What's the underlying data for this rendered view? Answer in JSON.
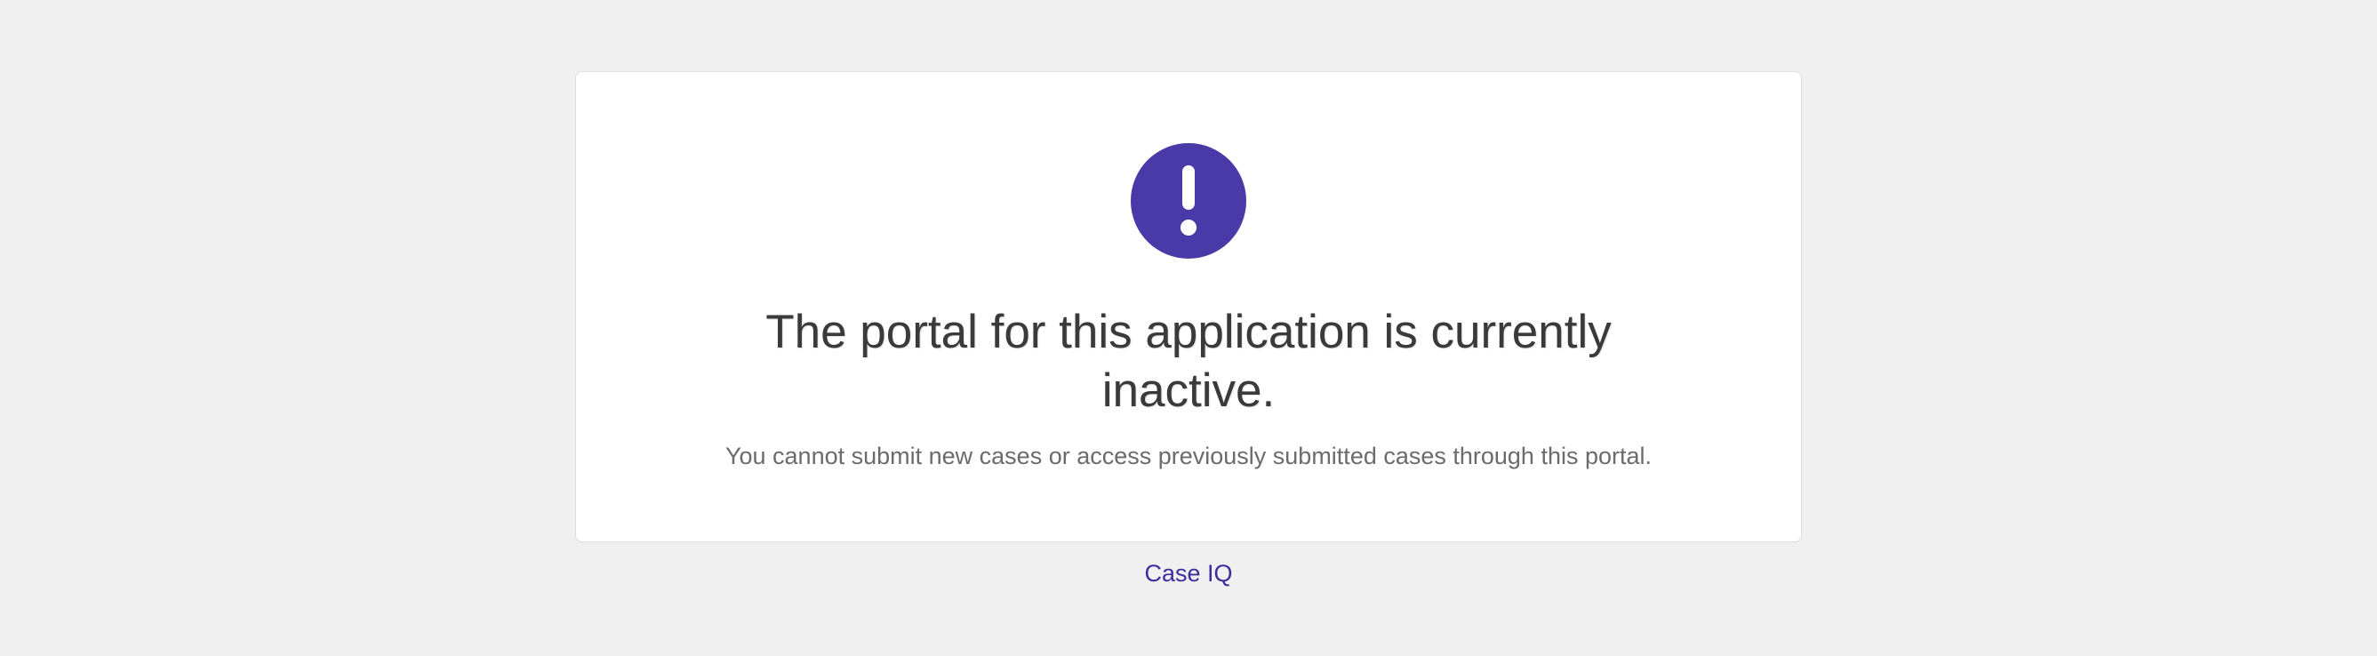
{
  "icon": "exclamation-circle",
  "heading": "The portal for this application is currently inactive.",
  "subtext": "You cannot submit new cases or access previously submitted cases through this portal.",
  "footer_link": "Case IQ",
  "colors": {
    "accent": "#4a3aa8",
    "link": "#3d2e9e"
  }
}
